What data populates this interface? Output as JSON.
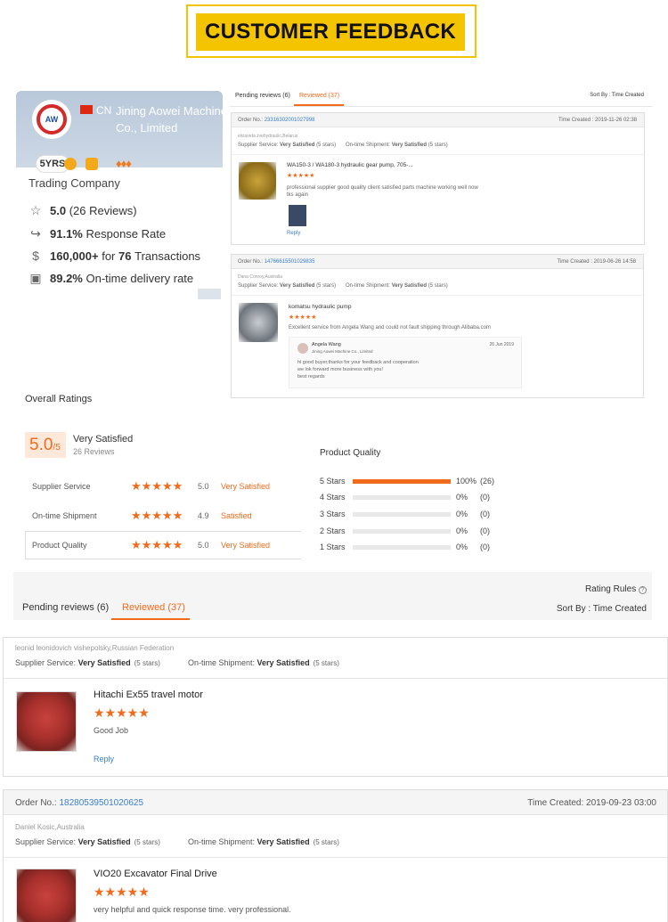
{
  "banner": {
    "title": "CUSTOMER FEEDBACK"
  },
  "supplier": {
    "country_code": "CN",
    "name": "Jining Aowei Machine Co., Limited",
    "years": "5YRS",
    "type": "Trading Company",
    "rating": "5.0",
    "reviews": "(26 Reviews)",
    "response_rate": "91.1%",
    "response_label": "Response Rate",
    "transactions_amount": "160,000+",
    "transactions_mid": "for",
    "transactions_count": "76",
    "transactions_label": "Transactions",
    "delivery_rate": "89.2%",
    "delivery_label": "On-time delivery rate"
  },
  "mini_tabs": {
    "pending": "Pending reviews (6)",
    "reviewed": "Reviewed (37)",
    "sort": "Sort By : Time Created"
  },
  "mini_reviews": [
    {
      "order_label": "Order No.:",
      "order_no": "23316302001027998",
      "time": "Time Created : 2019-11-26 02:38",
      "name": "elizaveta zvehydraulic,Belarus",
      "supplier_service": "Supplier Service:",
      "supplier_val": "Very Satisfied",
      "supplier_stars": "(5 stars)",
      "shipment": "On-time Shipment:",
      "shipment_val": "Very Satisfied",
      "shipment_stars": "(5 stars)",
      "product": "WA150-3 / WA180-3 hydraulic gear pump, 705-...",
      "text": "professional supplier good quality client  satisfied parts machine working well now tks again",
      "reply": "Reply"
    },
    {
      "order_label": "Order No.:",
      "order_no": "14766615501029835",
      "time": "Time Created : 2019-06-26 14:58",
      "name": "Dana Conroy,Australia",
      "supplier_service": "Supplier Service:",
      "supplier_val": "Very Satisfied",
      "supplier_stars": "(5 stars)",
      "shipment": "On-time Shipment:",
      "shipment_val": "Very Satisfied",
      "shipment_stars": "(5 stars)",
      "product": "komatsu hydraulic pump",
      "text": "Excellent service from Angela Wang and could not fault shipping through Alibaba.com",
      "responder": "Angela Wang",
      "responder_company": "Jining Aowei Machine Co., Limited",
      "response_date": "26 Jun 2019",
      "response_text_1": "hi good buyer,thanks for your feedback and cooperation",
      "response_text_2": "we lok forward more business with you!",
      "response_text_3": "best regards"
    }
  ],
  "overall": {
    "title": "Overall Ratings",
    "score": "5.0",
    "score_den": "/5",
    "label": "Very Satisfied",
    "count": "26 Reviews",
    "rows": [
      {
        "name": "Supplier Service",
        "value": "5.0",
        "label": "Very Satisfied"
      },
      {
        "name": "On-time Shipment",
        "value": "4.9",
        "label": "Satisfied"
      },
      {
        "name": "Product Quality",
        "value": "5.0",
        "label": "Very Satisfied"
      }
    ],
    "pq_title": "Product Quality",
    "bars": [
      {
        "label": "5 Stars",
        "pct": "100%",
        "count": "(26)",
        "fill": 1.0
      },
      {
        "label": "4 Stars",
        "pct": "0%",
        "count": "(0)",
        "fill": 0
      },
      {
        "label": "3 Stars",
        "pct": "0%",
        "count": "(0)",
        "fill": 0
      },
      {
        "label": "2 Stars",
        "pct": "0%",
        "count": "(0)",
        "fill": 0
      },
      {
        "label": "1 Stars",
        "pct": "0%",
        "count": "(0)",
        "fill": 0
      }
    ]
  },
  "tabbar": {
    "rating_rules": "Rating Rules",
    "pending": "Pending reviews (6)",
    "reviewed": "Reviewed (37)",
    "sort": "Sort By : Time Created"
  },
  "reviews": [
    {
      "name": "leonid leonidovich vishepolsky,Russian Federation",
      "supplier_service": "Supplier Service:",
      "supplier_val": "Very Satisfied",
      "supplier_stars": "(5 stars)",
      "shipment": "On-time Shipment:",
      "shipment_val": "Very Satisfied",
      "shipment_stars": "(5 stars)",
      "product": "Hitachi Ex55 travel motor",
      "text": "Good Job",
      "reply": "Reply"
    },
    {
      "order_label": "Order No.:",
      "order_no": "18280539501020625",
      "time": "Time Created: 2019-09-23 03:00",
      "name": "Daniel Kosic,Australia",
      "supplier_service": "Supplier Service:",
      "supplier_val": "Very Satisfied",
      "supplier_stars": "(5 stars)",
      "shipment": "On-time Shipment:",
      "shipment_val": "Very Satisfied",
      "shipment_stars": "(5 stars)",
      "product": "VIO20 Excavator Final Drive",
      "text": "very helpful and quick response time. very professional."
    }
  ],
  "colors": {
    "accent": "#f26a1b",
    "banner": "#f5c400",
    "link": "#3a7fcf"
  }
}
